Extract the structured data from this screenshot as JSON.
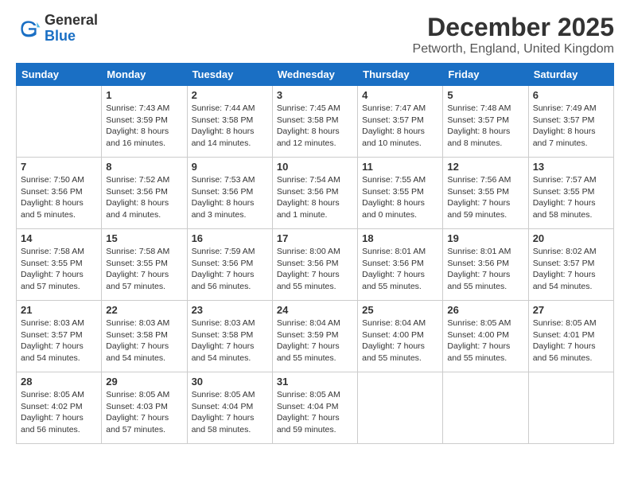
{
  "header": {
    "logo_general": "General",
    "logo_blue": "Blue",
    "month_title": "December 2025",
    "location": "Petworth, England, United Kingdom"
  },
  "days_of_week": [
    "Sunday",
    "Monday",
    "Tuesday",
    "Wednesday",
    "Thursday",
    "Friday",
    "Saturday"
  ],
  "weeks": [
    [
      {
        "day": "",
        "info": ""
      },
      {
        "day": "1",
        "info": "Sunrise: 7:43 AM\nSunset: 3:59 PM\nDaylight: 8 hours\nand 16 minutes."
      },
      {
        "day": "2",
        "info": "Sunrise: 7:44 AM\nSunset: 3:58 PM\nDaylight: 8 hours\nand 14 minutes."
      },
      {
        "day": "3",
        "info": "Sunrise: 7:45 AM\nSunset: 3:58 PM\nDaylight: 8 hours\nand 12 minutes."
      },
      {
        "day": "4",
        "info": "Sunrise: 7:47 AM\nSunset: 3:57 PM\nDaylight: 8 hours\nand 10 minutes."
      },
      {
        "day": "5",
        "info": "Sunrise: 7:48 AM\nSunset: 3:57 PM\nDaylight: 8 hours\nand 8 minutes."
      },
      {
        "day": "6",
        "info": "Sunrise: 7:49 AM\nSunset: 3:57 PM\nDaylight: 8 hours\nand 7 minutes."
      }
    ],
    [
      {
        "day": "7",
        "info": "Sunrise: 7:50 AM\nSunset: 3:56 PM\nDaylight: 8 hours\nand 5 minutes."
      },
      {
        "day": "8",
        "info": "Sunrise: 7:52 AM\nSunset: 3:56 PM\nDaylight: 8 hours\nand 4 minutes."
      },
      {
        "day": "9",
        "info": "Sunrise: 7:53 AM\nSunset: 3:56 PM\nDaylight: 8 hours\nand 3 minutes."
      },
      {
        "day": "10",
        "info": "Sunrise: 7:54 AM\nSunset: 3:56 PM\nDaylight: 8 hours\nand 1 minute."
      },
      {
        "day": "11",
        "info": "Sunrise: 7:55 AM\nSunset: 3:55 PM\nDaylight: 8 hours\nand 0 minutes."
      },
      {
        "day": "12",
        "info": "Sunrise: 7:56 AM\nSunset: 3:55 PM\nDaylight: 7 hours\nand 59 minutes."
      },
      {
        "day": "13",
        "info": "Sunrise: 7:57 AM\nSunset: 3:55 PM\nDaylight: 7 hours\nand 58 minutes."
      }
    ],
    [
      {
        "day": "14",
        "info": "Sunrise: 7:58 AM\nSunset: 3:55 PM\nDaylight: 7 hours\nand 57 minutes."
      },
      {
        "day": "15",
        "info": "Sunrise: 7:58 AM\nSunset: 3:55 PM\nDaylight: 7 hours\nand 57 minutes."
      },
      {
        "day": "16",
        "info": "Sunrise: 7:59 AM\nSunset: 3:56 PM\nDaylight: 7 hours\nand 56 minutes."
      },
      {
        "day": "17",
        "info": "Sunrise: 8:00 AM\nSunset: 3:56 PM\nDaylight: 7 hours\nand 55 minutes."
      },
      {
        "day": "18",
        "info": "Sunrise: 8:01 AM\nSunset: 3:56 PM\nDaylight: 7 hours\nand 55 minutes."
      },
      {
        "day": "19",
        "info": "Sunrise: 8:01 AM\nSunset: 3:56 PM\nDaylight: 7 hours\nand 55 minutes."
      },
      {
        "day": "20",
        "info": "Sunrise: 8:02 AM\nSunset: 3:57 PM\nDaylight: 7 hours\nand 54 minutes."
      }
    ],
    [
      {
        "day": "21",
        "info": "Sunrise: 8:03 AM\nSunset: 3:57 PM\nDaylight: 7 hours\nand 54 minutes."
      },
      {
        "day": "22",
        "info": "Sunrise: 8:03 AM\nSunset: 3:58 PM\nDaylight: 7 hours\nand 54 minutes."
      },
      {
        "day": "23",
        "info": "Sunrise: 8:03 AM\nSunset: 3:58 PM\nDaylight: 7 hours\nand 54 minutes."
      },
      {
        "day": "24",
        "info": "Sunrise: 8:04 AM\nSunset: 3:59 PM\nDaylight: 7 hours\nand 55 minutes."
      },
      {
        "day": "25",
        "info": "Sunrise: 8:04 AM\nSunset: 4:00 PM\nDaylight: 7 hours\nand 55 minutes."
      },
      {
        "day": "26",
        "info": "Sunrise: 8:05 AM\nSunset: 4:00 PM\nDaylight: 7 hours\nand 55 minutes."
      },
      {
        "day": "27",
        "info": "Sunrise: 8:05 AM\nSunset: 4:01 PM\nDaylight: 7 hours\nand 56 minutes."
      }
    ],
    [
      {
        "day": "28",
        "info": "Sunrise: 8:05 AM\nSunset: 4:02 PM\nDaylight: 7 hours\nand 56 minutes."
      },
      {
        "day": "29",
        "info": "Sunrise: 8:05 AM\nSunset: 4:03 PM\nDaylight: 7 hours\nand 57 minutes."
      },
      {
        "day": "30",
        "info": "Sunrise: 8:05 AM\nSunset: 4:04 PM\nDaylight: 7 hours\nand 58 minutes."
      },
      {
        "day": "31",
        "info": "Sunrise: 8:05 AM\nSunset: 4:04 PM\nDaylight: 7 hours\nand 59 minutes."
      },
      {
        "day": "",
        "info": ""
      },
      {
        "day": "",
        "info": ""
      },
      {
        "day": "",
        "info": ""
      }
    ]
  ]
}
